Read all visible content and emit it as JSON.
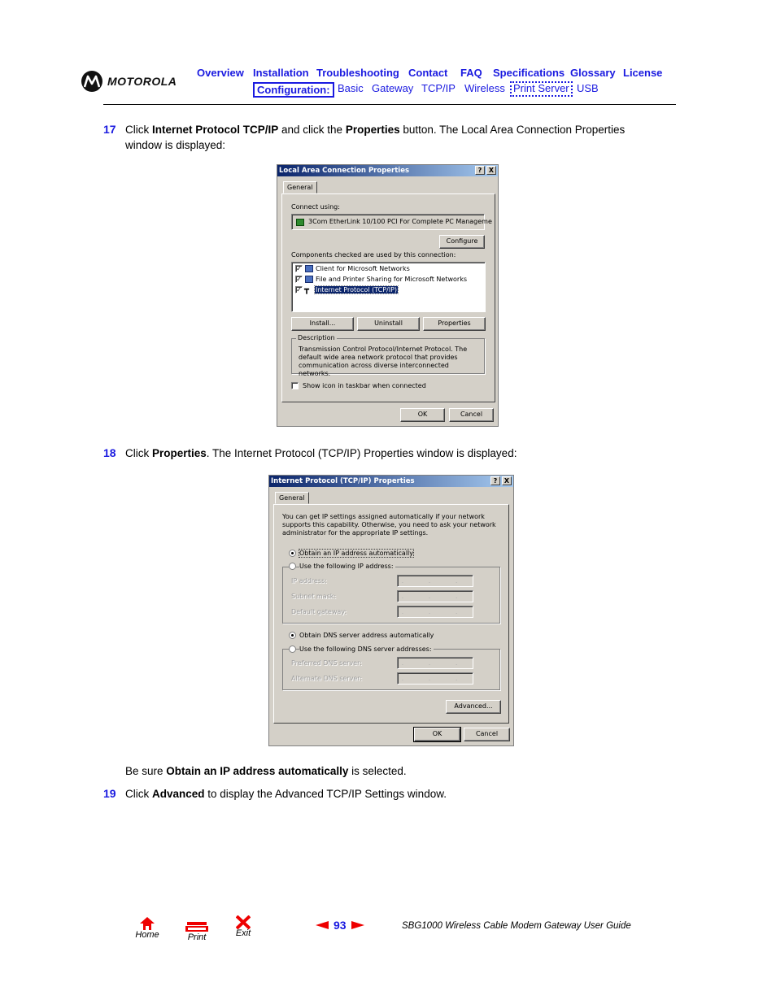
{
  "header": {
    "brand": "MOTOROLA",
    "nav_top": [
      {
        "label": "Overview"
      },
      {
        "label": "Installation"
      },
      {
        "label": "Troubleshooting"
      },
      {
        "label": "Contact"
      },
      {
        "label": "FAQ"
      },
      {
        "label": "Specifications"
      },
      {
        "label": "Glossary"
      },
      {
        "label": "License"
      }
    ],
    "nav_sub_label": "Configuration:",
    "nav_sub": [
      {
        "label": "Basic"
      },
      {
        "label": "Gateway"
      },
      {
        "label": "TCP/IP"
      },
      {
        "label": "Wireless"
      },
      {
        "label": "Print Server"
      },
      {
        "label": "USB"
      }
    ],
    "accent_color": "#1a1ae0"
  },
  "steps": {
    "s17": {
      "number": "17",
      "t1": "Click ",
      "b1": "Internet Protocol TCP/IP",
      "t2": " and click the ",
      "b2": "Properties",
      "t3": " button. The Local Area Connection Properties window is displayed:"
    },
    "s18": {
      "number": "18",
      "t1": "Click ",
      "b1": "Properties",
      "t2": ". The Internet Protocol (TCP/IP) Properties window is displayed:"
    },
    "note": {
      "t1": "Be sure ",
      "b1": "Obtain an IP address automatically",
      "t2": " is selected."
    },
    "s19": {
      "number": "19",
      "t1": "Click ",
      "b1": "Advanced",
      "t2": " to display the Advanced TCP/IP Settings window."
    }
  },
  "dialog1": {
    "title": "Local Area Connection Properties",
    "help_btn": "?",
    "close_btn": "X",
    "tab": "General",
    "connect_using_label": "Connect using:",
    "adapter": "3Com EtherLink 10/100 PCI For Complete PC Manageme",
    "configure_btn": "Configure",
    "components_label": "Components checked are used by this connection:",
    "components": [
      {
        "label": "Client for Microsoft Networks",
        "checked": true,
        "icon": "network-client-icon"
      },
      {
        "label": "File and Printer Sharing for Microsoft Networks",
        "checked": true,
        "icon": "file-printer-sharing-icon"
      },
      {
        "label": "Internet Protocol (TCP/IP)",
        "checked": true,
        "icon": "protocol-icon",
        "selected": true
      }
    ],
    "install_btn": "Install...",
    "uninstall_btn": "Uninstall",
    "properties_btn": "Properties",
    "description_title": "Description",
    "description": "Transmission Control Protocol/Internet Protocol. The default wide area network protocol that provides communication across diverse interconnected networks.",
    "show_icon_label": "Show icon in taskbar when connected",
    "show_icon_checked": false,
    "ok_btn": "OK",
    "cancel_btn": "Cancel"
  },
  "dialog2": {
    "title": "Internet Protocol (TCP/IP) Properties",
    "help_btn": "?",
    "close_btn": "X",
    "tab": "General",
    "intro": "You can get IP settings assigned automatically if your network supports this capability. Otherwise, you need to ask your network administrator for the appropriate IP settings.",
    "obtain_ip_label": "Obtain an IP address automatically",
    "obtain_ip_selected": true,
    "use_ip_label": "Use the following IP address:",
    "ip_address_label": "IP address:",
    "subnet_label": "Subnet mask:",
    "gateway_label": "Default gateway:",
    "ip_placeholder": ". . .",
    "obtain_dns_label": "Obtain DNS server address automatically",
    "obtain_dns_selected": true,
    "use_dns_label": "Use the following DNS server addresses:",
    "preferred_dns_label": "Preferred DNS server:",
    "alternate_dns_label": "Alternate DNS server:",
    "advanced_btn": "Advanced...",
    "ok_btn": "OK",
    "cancel_btn": "Cancel"
  },
  "footer": {
    "home_label": "Home",
    "print_label": "Print",
    "exit_label": "Exit",
    "page_number": "93",
    "guide_title": "SBG1000 Wireless Cable Modem Gateway User Guide",
    "icon_color": "#ee0000"
  }
}
